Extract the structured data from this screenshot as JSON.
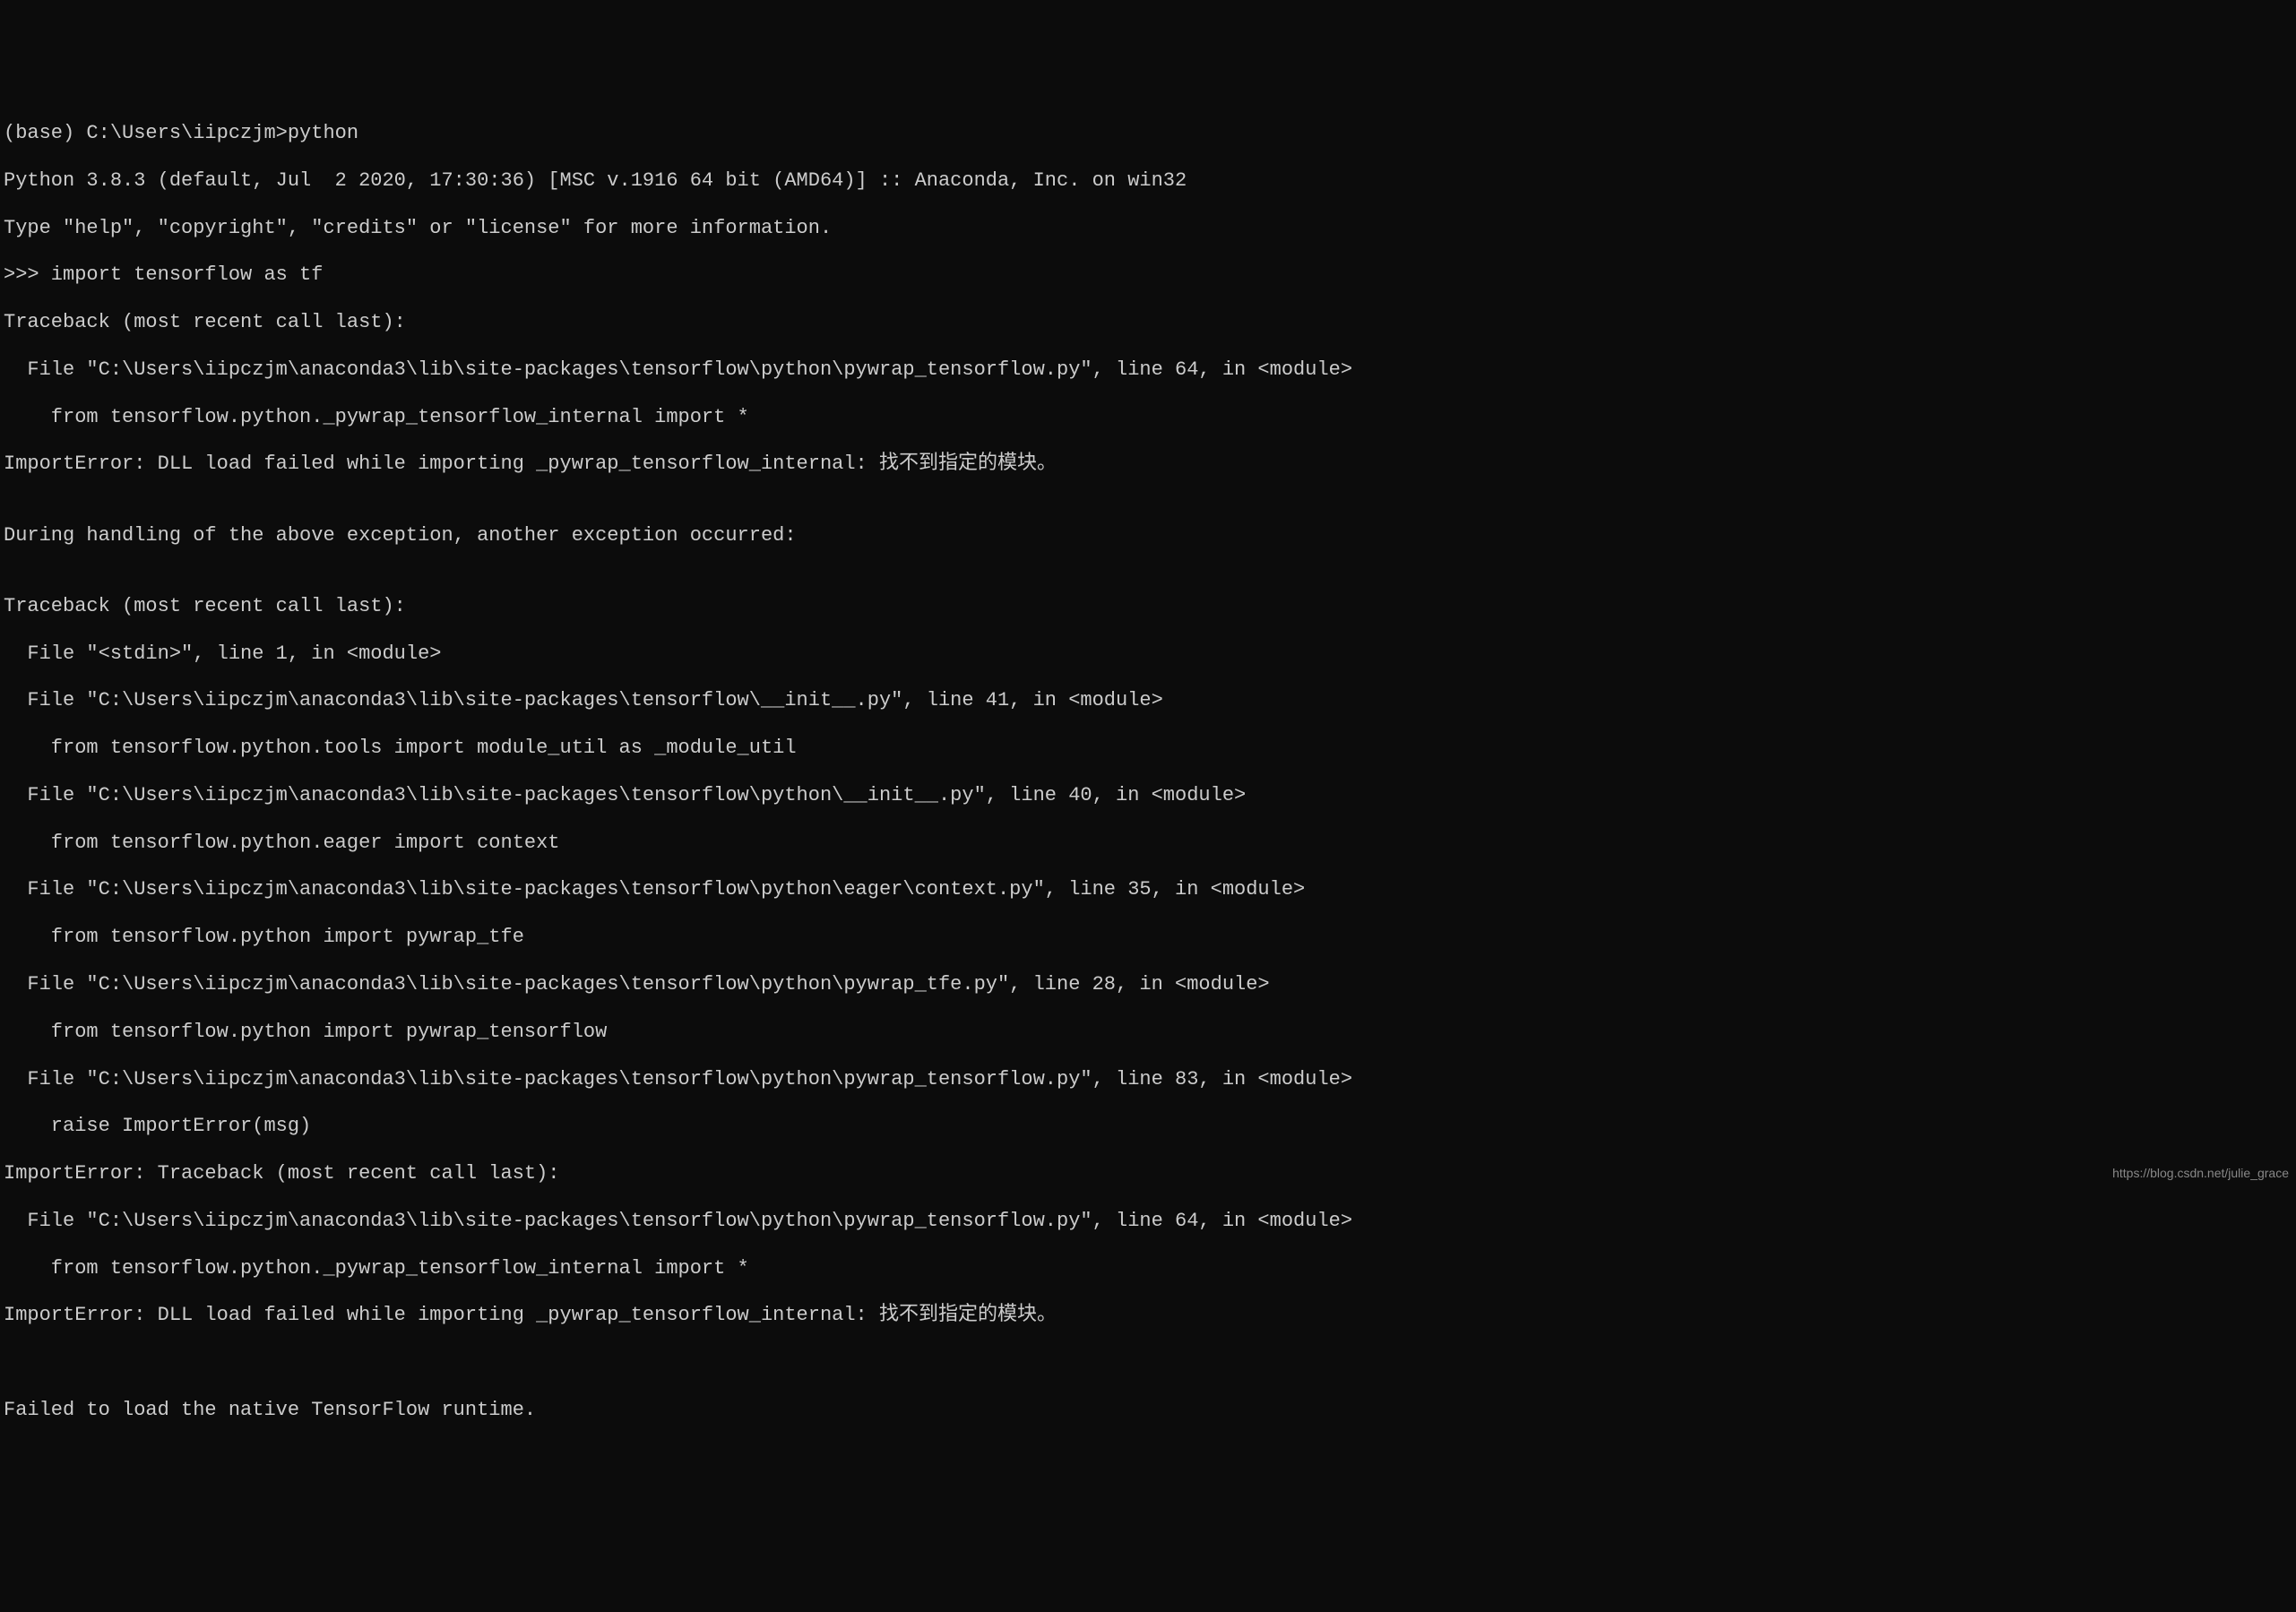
{
  "terminal": {
    "lines": [
      "(base) C:\\Users\\iipczjm>python",
      "Python 3.8.3 (default, Jul  2 2020, 17:30:36) [MSC v.1916 64 bit (AMD64)] :: Anaconda, Inc. on win32",
      "Type \"help\", \"copyright\", \"credits\" or \"license\" for more information.",
      ">>> import tensorflow as tf",
      "Traceback (most recent call last):",
      "  File \"C:\\Users\\iipczjm\\anaconda3\\lib\\site-packages\\tensorflow\\python\\pywrap_tensorflow.py\", line 64, in <module>",
      "    from tensorflow.python._pywrap_tensorflow_internal import *",
      "ImportError: DLL load failed while importing _pywrap_tensorflow_internal: 找不到指定的模块。",
      "",
      "During handling of the above exception, another exception occurred:",
      "",
      "Traceback (most recent call last):",
      "  File \"<stdin>\", line 1, in <module>",
      "  File \"C:\\Users\\iipczjm\\anaconda3\\lib\\site-packages\\tensorflow\\__init__.py\", line 41, in <module>",
      "    from tensorflow.python.tools import module_util as _module_util",
      "  File \"C:\\Users\\iipczjm\\anaconda3\\lib\\site-packages\\tensorflow\\python\\__init__.py\", line 40, in <module>",
      "    from tensorflow.python.eager import context",
      "  File \"C:\\Users\\iipczjm\\anaconda3\\lib\\site-packages\\tensorflow\\python\\eager\\context.py\", line 35, in <module>",
      "    from tensorflow.python import pywrap_tfe",
      "  File \"C:\\Users\\iipczjm\\anaconda3\\lib\\site-packages\\tensorflow\\python\\pywrap_tfe.py\", line 28, in <module>",
      "    from tensorflow.python import pywrap_tensorflow",
      "  File \"C:\\Users\\iipczjm\\anaconda3\\lib\\site-packages\\tensorflow\\python\\pywrap_tensorflow.py\", line 83, in <module>",
      "    raise ImportError(msg)",
      "ImportError: Traceback (most recent call last):",
      "  File \"C:\\Users\\iipczjm\\anaconda3\\lib\\site-packages\\tensorflow\\python\\pywrap_tensorflow.py\", line 64, in <module>",
      "    from tensorflow.python._pywrap_tensorflow_internal import *",
      "ImportError: DLL load failed while importing _pywrap_tensorflow_internal: 找不到指定的模块。",
      "",
      "",
      "Failed to load the native TensorFlow runtime."
    ]
  },
  "watermark": "https://blog.csdn.net/julie_grace"
}
